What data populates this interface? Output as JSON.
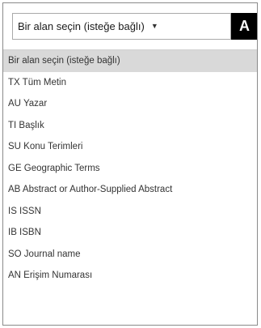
{
  "field_select": {
    "selected_label": "Bir alan seçin (isteğe bağlı)",
    "caret_icon": "caret-down-icon"
  },
  "search_button": {
    "visible_text": "A"
  },
  "options": [
    {
      "label": "Bir alan seçin (isteğe bağlı)",
      "selected": true
    },
    {
      "label": "TX Tüm Metin"
    },
    {
      "label": "AU Yazar"
    },
    {
      "label": "TI Başlık"
    },
    {
      "label": "SU Konu Terimleri"
    },
    {
      "label": "GE Geographic Terms"
    },
    {
      "label": "AB Abstract or Author-Supplied Abstract"
    },
    {
      "label": "IS ISSN"
    },
    {
      "label": "IB ISBN"
    },
    {
      "label": "SO Journal name"
    },
    {
      "label": "AN Erişim Numarası"
    }
  ],
  "colors": {
    "selected_bg": "#d9d9d9",
    "button_bg": "#000000",
    "border": "#a9a9a9"
  }
}
